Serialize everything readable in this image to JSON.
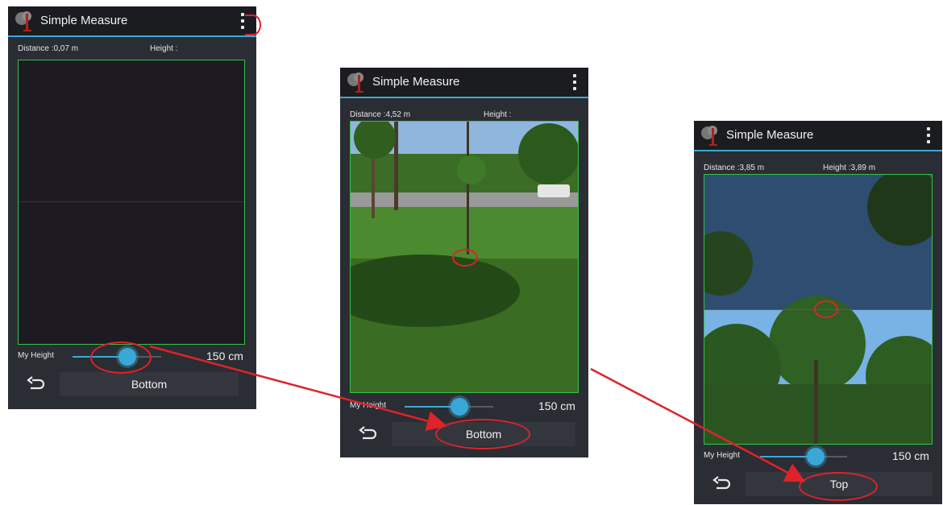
{
  "screens": [
    {
      "app_title": "Simple Measure",
      "distance": "Distance :0,07 m",
      "height": "Height :",
      "my_height_label": "My Height",
      "height_value": "150 cm",
      "slider_fraction": 0.64,
      "button_label": "Bottom"
    },
    {
      "app_title": "Simple Measure",
      "distance": "Distance :4,52 m",
      "height": "Height :",
      "my_height_label": "My Height",
      "height_value": "150 cm",
      "slider_fraction": 0.64,
      "button_label": "Bottom"
    },
    {
      "app_title": "Simple Measure",
      "distance": "Distance :3,85 m",
      "height": "Height :3,89 m",
      "my_height_label": "My Height",
      "height_value": "150 cm",
      "slider_fraction": 0.64,
      "button_label": "Top"
    }
  ],
  "colors": {
    "accent": "#3aa8d6",
    "preview_border": "#33c24a",
    "annotation": "#e0222a"
  },
  "icons": [
    "tree-logo-icon",
    "overflow-menu-icon",
    "back-icon"
  ]
}
